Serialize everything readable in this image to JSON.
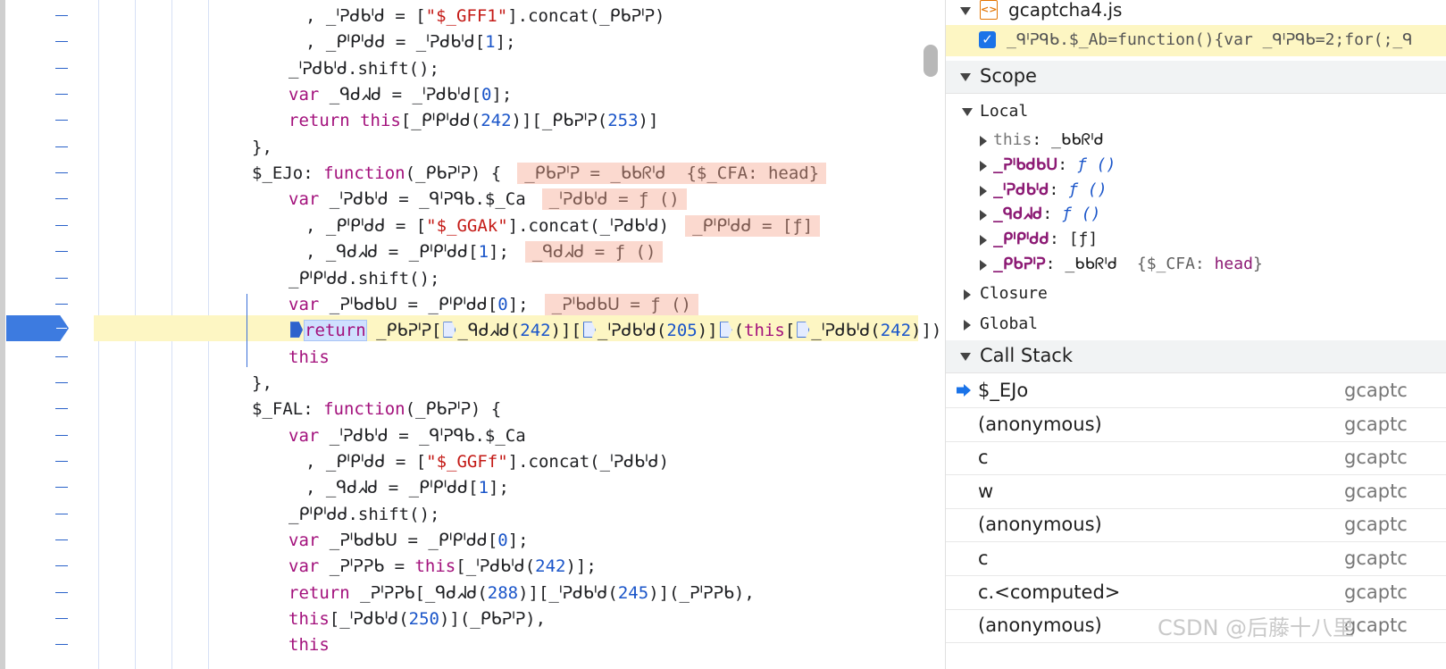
{
  "editor": {
    "lines": [
      {
        "indent": 342,
        "segments": [
          {
            "t": ", "
          },
          {
            "t": "_ᑊᕈᑯᑲᑊᑯ"
          },
          {
            "t": " = ["
          },
          {
            "t": "\"$_GFF1\"",
            "c": "str"
          },
          {
            "t": "].concat(_ᑭᑲᕈᑊᕈ)"
          }
        ]
      },
      {
        "indent": 342,
        "segments": [
          {
            "t": ", "
          },
          {
            "t": "_ᑭᑊᑭᑊᑯᑯ"
          },
          {
            "t": " = _ᑊᕈᑯᑲᑊᑯ["
          },
          {
            "t": "1",
            "c": "num"
          },
          {
            "t": "];"
          }
        ]
      },
      {
        "indent": 323,
        "segments": [
          {
            "t": "_ᑊᕈᑯᑲᑊᑯ.shift();"
          }
        ]
      },
      {
        "indent": 323,
        "segments": [
          {
            "t": "var ",
            "c": "kw"
          },
          {
            "t": "_ᑫᑯᖽᑯ = _ᑊᕈᑯᑲᑊᑯ["
          },
          {
            "t": "0",
            "c": "num"
          },
          {
            "t": "];"
          }
        ]
      },
      {
        "indent": 323,
        "segments": [
          {
            "t": "return ",
            "c": "kw"
          },
          {
            "t": "this",
            "c": "kw"
          },
          {
            "t": "[_ᑭᑊᑭᑊᑯᑯ("
          },
          {
            "t": "242",
            "c": "num"
          },
          {
            "t": ")][_ᑭᑲᕈᑊᕈ("
          },
          {
            "t": "253",
            "c": "num"
          },
          {
            "t": ")]"
          }
        ]
      },
      {
        "indent": 282,
        "segments": [
          {
            "t": "},"
          }
        ]
      },
      {
        "indent": 282,
        "segments": [
          {
            "t": "$_EJo: "
          },
          {
            "t": "function",
            "c": "kw"
          },
          {
            "t": "(_ᑭᑲᕈᑊᕈ) {"
          }
        ],
        "inline": "_ᑭᑲᕈᑊᕈ = _ᑲᑲᖇᑊᑯ  {$_CFA: head}"
      },
      {
        "indent": 323,
        "segments": [
          {
            "t": "var ",
            "c": "kw"
          },
          {
            "t": "_ᑊᕈᑯᑲᑊᑯ = _ᑫᑊᕈᑫᑲ.$_Ca"
          }
        ],
        "inline": "_ᑊᕈᑯᑲᑊᑯ = ƒ ()"
      },
      {
        "indent": 342,
        "segments": [
          {
            "t": ", "
          },
          {
            "t": "_ᑭᑊᑭᑊᑯᑯ = ["
          },
          {
            "t": "\"$_GGAk\"",
            "c": "str"
          },
          {
            "t": "].concat(_ᑊᕈᑯᑲᑊᑯ)"
          }
        ],
        "inline": "_ᑭᑊᑭᑊᑯᑯ = [ƒ]"
      },
      {
        "indent": 342,
        "segments": [
          {
            "t": ", "
          },
          {
            "t": "_ᑫᑯᖽᑯ = _ᑭᑊᑭᑊᑯᑯ["
          },
          {
            "t": "1",
            "c": "num"
          },
          {
            "t": "];"
          }
        ],
        "inline": "_ᑫᑯᖽᑯ = ƒ ()"
      },
      {
        "indent": 323,
        "segments": [
          {
            "t": "_ᑭᑊᑭᑊᑯᑯ.shift();"
          }
        ]
      },
      {
        "indent": 323,
        "segments": [
          {
            "t": "var ",
            "c": "kw"
          },
          {
            "t": "_ᕈᑊᑲᑯᑲᑌ = _ᑭᑊᑭᑊᑯᑯ["
          },
          {
            "t": "0",
            "c": "num"
          },
          {
            "t": "];"
          }
        ],
        "inline": "_ᕈᑊᑲᑯᑲᑌ = ƒ ()"
      },
      {
        "indent": 323,
        "exec": true,
        "segments": [
          {
            "bp": "solid"
          },
          {
            "t": "return",
            "c": "kw sel"
          },
          {
            "t": " _ᑭᑲᕈᑊᕈ["
          },
          {
            "bp": "open"
          },
          {
            "t": "_ᑫᑯᖽᑯ("
          },
          {
            "t": "242",
            "c": "num"
          },
          {
            "t": ")]["
          },
          {
            "bp": "open"
          },
          {
            "t": "_ᑊᕈᑯᑲᑊᑯ("
          },
          {
            "t": "205",
            "c": "num"
          },
          {
            "t": ")]"
          },
          {
            "bp": "open"
          },
          {
            "t": "("
          },
          {
            "t": "this",
            "c": "kw"
          },
          {
            "t": "["
          },
          {
            "bp": "open"
          },
          {
            "t": "_ᑊᕈᑯᑲᑊᑯ("
          },
          {
            "t": "242",
            "c": "num"
          },
          {
            "t": ")]),"
          }
        ]
      },
      {
        "indent": 323,
        "segments": [
          {
            "t": "this",
            "c": "kw"
          }
        ]
      },
      {
        "indent": 282,
        "segments": [
          {
            "t": "},"
          }
        ]
      },
      {
        "indent": 282,
        "segments": [
          {
            "t": "$_FAL: "
          },
          {
            "t": "function",
            "c": "kw"
          },
          {
            "t": "(_ᑭᑲᕈᑊᕈ) {"
          }
        ]
      },
      {
        "indent": 323,
        "segments": [
          {
            "t": "var ",
            "c": "kw"
          },
          {
            "t": "_ᑊᕈᑯᑲᑊᑯ = _ᑫᑊᕈᑫᑲ.$_Ca"
          }
        ]
      },
      {
        "indent": 342,
        "segments": [
          {
            "t": ", "
          },
          {
            "t": "_ᑭᑊᑭᑊᑯᑯ = ["
          },
          {
            "t": "\"$_GGFf\"",
            "c": "str"
          },
          {
            "t": "].concat(_ᑊᕈᑯᑲᑊᑯ)"
          }
        ]
      },
      {
        "indent": 342,
        "segments": [
          {
            "t": ", "
          },
          {
            "t": "_ᑫᑯᖽᑯ = _ᑭᑊᑭᑊᑯᑯ["
          },
          {
            "t": "1",
            "c": "num"
          },
          {
            "t": "];"
          }
        ]
      },
      {
        "indent": 323,
        "segments": [
          {
            "t": "_ᑭᑊᑭᑊᑯᑯ.shift();"
          }
        ]
      },
      {
        "indent": 323,
        "segments": [
          {
            "t": "var ",
            "c": "kw"
          },
          {
            "t": "_ᕈᑊᑲᑯᑲᑌ = _ᑭᑊᑭᑊᑯᑯ["
          },
          {
            "t": "0",
            "c": "num"
          },
          {
            "t": "];"
          }
        ]
      },
      {
        "indent": 323,
        "segments": [
          {
            "t": "var ",
            "c": "kw"
          },
          {
            "t": "_ᕈᑊᕈᕈᑲ = "
          },
          {
            "t": "this",
            "c": "kw"
          },
          {
            "t": "[_ᑊᕈᑯᑲᑊᑯ("
          },
          {
            "t": "242",
            "c": "num"
          },
          {
            "t": ")];"
          }
        ]
      },
      {
        "indent": 323,
        "segments": [
          {
            "t": "return ",
            "c": "kw"
          },
          {
            "t": "_ᕈᑊᕈᕈᑲ[_ᑫᑯᖽᑯ("
          },
          {
            "t": "288",
            "c": "num"
          },
          {
            "t": ")][_ᑊᕈᑯᑲᑊᑯ("
          },
          {
            "t": "245",
            "c": "num"
          },
          {
            "t": ")](_ᕈᑊᕈᕈᑲ),"
          }
        ]
      },
      {
        "indent": 323,
        "segments": [
          {
            "t": "this",
            "c": "kw"
          },
          {
            "t": "[_ᑊᕈᑯᑲᑊᑯ("
          },
          {
            "t": "250",
            "c": "num"
          },
          {
            "t": ")](_ᑭᑲᕈᑊᕈ),"
          }
        ]
      },
      {
        "indent": 323,
        "segments": [
          {
            "t": "this",
            "c": "kw"
          }
        ]
      }
    ]
  },
  "breakpoints": {
    "file": "gcaptcha4.js",
    "entry": "_ᑫᑊᕈᑫᑲ.$_Ab=function(){var _ᑫᑊᕈᑫᑲ=2;for(;_ᑫ"
  },
  "scope": {
    "title": "Scope",
    "local_label": "Local",
    "locals": [
      {
        "name": "this",
        "sep": ": ",
        "value": "_ᑲᑲᖇᑊᑯ",
        "kind": "this"
      },
      {
        "name": "_ᕈᑊᑲᑯᑲᑌ",
        "sep": ": ",
        "value": "ƒ ()",
        "kind": "fn"
      },
      {
        "name": "_ᑊᕈᑯᑲᑊᑯ",
        "sep": ": ",
        "value": "ƒ ()",
        "kind": "fn"
      },
      {
        "name": "_ᑫᑯᖽᑯ",
        "sep": ": ",
        "value": "ƒ ()",
        "kind": "fn"
      },
      {
        "name": "_ᑭᑊᑭᑊᑯᑯ",
        "sep": ": ",
        "value": "[ƒ]",
        "kind": "arr"
      },
      {
        "name": "_ᑭᑲᕈᑊᕈ",
        "sep": ": ",
        "value": "_ᑲᑲᖇᑊᑯ",
        "extra_key": "$_CFA",
        "extra_val": "head",
        "kind": "obj"
      }
    ],
    "closure_label": "Closure",
    "global_label": "Global"
  },
  "call_stack": {
    "title": "Call Stack",
    "frames": [
      {
        "name": "$_EJo",
        "loc": "gcaptc",
        "current": true
      },
      {
        "name": "(anonymous)",
        "loc": "gcaptc"
      },
      {
        "name": "c",
        "loc": "gcaptc"
      },
      {
        "name": "w",
        "loc": "gcaptc"
      },
      {
        "name": "(anonymous)",
        "loc": "gcaptc"
      },
      {
        "name": "c",
        "loc": "gcaptc"
      },
      {
        "name": "c.<computed>",
        "loc": "gcaptc"
      },
      {
        "name": "(anonymous)",
        "loc": "gcaptc"
      }
    ]
  },
  "watermark": "CSDN @后藤十八里",
  "colors": {
    "exec_highlight": "#fdf6c3",
    "accent": "#1a73e8",
    "keyword": "#a3117c",
    "string": "#c41a16",
    "number": "#1a55c9",
    "inline_value_bg": "#fbd9cf"
  }
}
